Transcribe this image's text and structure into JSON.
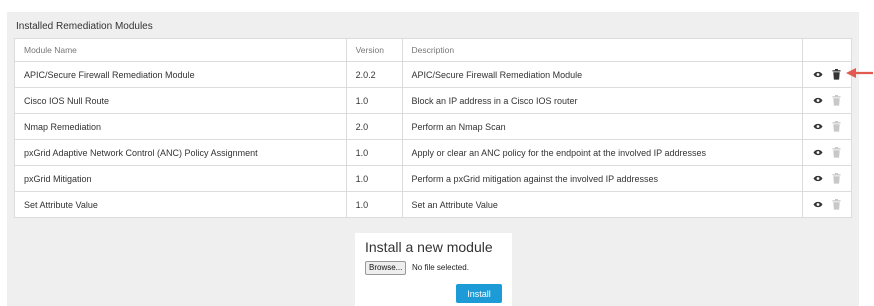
{
  "panel": {
    "title": "Installed Remediation Modules"
  },
  "table": {
    "columns": [
      "Module Name",
      "Version",
      "Description",
      ""
    ],
    "rows": [
      {
        "name": "APIC/Secure Firewall Remediation Module",
        "version": "2.0.2",
        "description": "APIC/Secure Firewall Remediation Module",
        "delete_enabled": true
      },
      {
        "name": "Cisco IOS Null Route",
        "version": "1.0",
        "description": "Block an IP address in a Cisco IOS router",
        "delete_enabled": false
      },
      {
        "name": "Nmap Remediation",
        "version": "2.0",
        "description": "Perform an Nmap Scan",
        "delete_enabled": false
      },
      {
        "name": "pxGrid Adaptive Network Control (ANC) Policy Assignment",
        "version": "1.0",
        "description": "Apply or clear an ANC policy for the endpoint at the involved IP addresses",
        "delete_enabled": false
      },
      {
        "name": "pxGrid Mitigation",
        "version": "1.0",
        "description": "Perform a pxGrid mitigation against the involved IP addresses",
        "delete_enabled": false
      },
      {
        "name": "Set Attribute Value",
        "version": "1.0",
        "description": "Set an Attribute Value",
        "delete_enabled": false
      }
    ]
  },
  "install": {
    "title": "Install a new module",
    "browse_label": "Browse...",
    "file_status": "No file selected.",
    "install_label": "Install"
  },
  "icons": {
    "view": "eye-icon",
    "delete": "trash-icon",
    "annotation": "arrow-icon"
  },
  "colors": {
    "accent": "#1c9bd6",
    "arrow": "#e05a4f",
    "icon_active": "#333333",
    "icon_disabled": "#c8c8c8"
  }
}
